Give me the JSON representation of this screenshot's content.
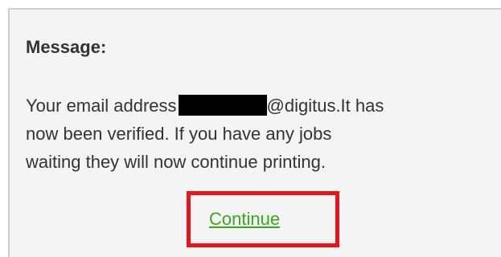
{
  "message": {
    "heading": "Message:",
    "line1_before": "Your email address",
    "line1_after": "@digitus.It has",
    "line2": "now been verified. If you have any jobs",
    "line3": "waiting they will now continue printing."
  },
  "actions": {
    "continue_label": "Continue"
  },
  "colors": {
    "link": "#3aa81c",
    "highlight_border": "#e8141b",
    "panel_bg": "#f4f4f4",
    "text": "#333333"
  }
}
